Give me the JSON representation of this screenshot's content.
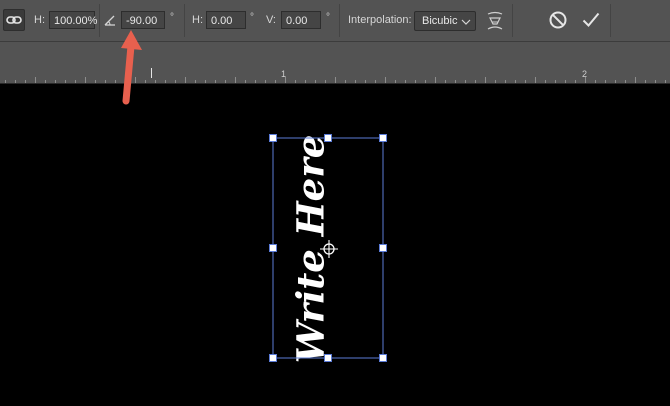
{
  "options_bar": {
    "width_label": "H:",
    "width_value": "100.00%",
    "angle_value": "-90.00",
    "degree_symbol": "°",
    "h_skew_label": "H:",
    "h_skew_value": "0.00",
    "v_skew_label": "V:",
    "v_skew_value": "0.00",
    "interpolation_label": "Interpolation:",
    "interpolation_value": "Bicubic"
  },
  "ruler": {
    "marks": [
      "1",
      "2"
    ]
  },
  "canvas": {
    "text": "Write Here",
    "rotation_degrees": -90,
    "bounding_box_color": "#5b7bd6",
    "text_color": "#ffffff"
  },
  "annotation": {
    "arrow_color": "#e8604e"
  },
  "icons": [
    "link-icon",
    "angle-icon",
    "warp-icon",
    "cancel-icon",
    "commit-icon",
    "chevron-down-icon",
    "reference-point-icon"
  ]
}
